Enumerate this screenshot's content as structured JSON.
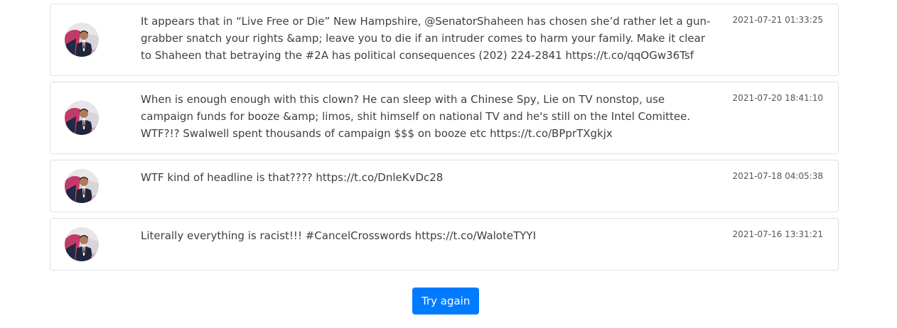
{
  "tweets": [
    {
      "text": "It appears that in “Live Free or Die” New Hampshire, @SenatorShaheen has chosen she’d rather let a gun-grabber snatch your rights &amp; leave you to die if an intruder comes to harm your family. Make it clear to Shaheen that betraying the #2A has political consequences (202) 224-2841 https://t.co/qqOGw36Tsf",
      "timestamp": "2021-07-21 01:33:25"
    },
    {
      "text": "When is enough enough with this clown? He can sleep with a Chinese Spy, Lie on TV nonstop, use campaign funds for booze &amp; limos, shit himself on national TV and he's still on the Intel Comittee. WTF?!? Swalwell spent thousands of campaign $$$ on booze etc https://t.co/BPprTXgkjx",
      "timestamp": "2021-07-20 18:41:10"
    },
    {
      "text": "WTF kind of headline is that???? https://t.co/DnleKvDc28",
      "timestamp": "2021-07-18 04:05:38"
    },
    {
      "text": "Literally everything is racist!!! #CancelCrosswords https://t.co/WaloteTYYI",
      "timestamp": "2021-07-16 13:31:21"
    }
  ],
  "actions": {
    "try_again_label": "Try again"
  },
  "colors": {
    "button_primary": "#007bff",
    "card_border": "#dee2e6"
  },
  "icons": {
    "avatar": "profile-photo"
  }
}
